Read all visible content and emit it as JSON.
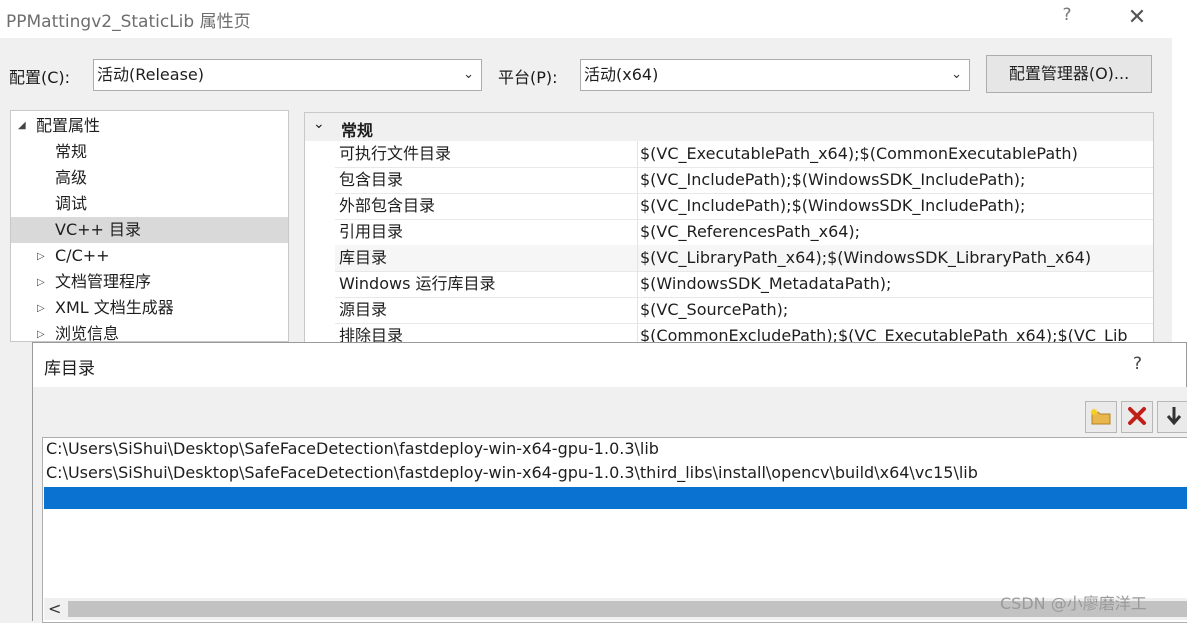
{
  "window": {
    "title": "PPMattingv2_StaticLib 属性页",
    "help": "?",
    "close": "✕"
  },
  "toolbar": {
    "config_label": "配置(C):",
    "config_value": "活动(Release)",
    "platform_label": "平台(P):",
    "platform_value": "活动(x64)",
    "manager_button": "配置管理器(O)..."
  },
  "tree": {
    "root": {
      "label": "配置属性",
      "toggle": "◢"
    },
    "items": [
      {
        "label": "常规"
      },
      {
        "label": "高级"
      },
      {
        "label": "调试"
      },
      {
        "label": "VC++ 目录",
        "selected": true
      }
    ],
    "collapsed": [
      {
        "label": "C/C++",
        "toggle": "▷"
      },
      {
        "label": "文档管理程序",
        "toggle": "▷"
      },
      {
        "label": "XML 文档生成器",
        "toggle": "▷"
      },
      {
        "label": "浏览信息",
        "toggle": "▷"
      }
    ]
  },
  "grid": {
    "section_toggle": "⌄",
    "section_title": "常规",
    "rows": [
      {
        "name": "可执行文件目录",
        "value": "$(VC_ExecutablePath_x64);$(CommonExecutablePath)"
      },
      {
        "name": "包含目录",
        "value": "$(VC_IncludePath);$(WindowsSDK_IncludePath);"
      },
      {
        "name": "外部包含目录",
        "value": "$(VC_IncludePath);$(WindowsSDK_IncludePath);"
      },
      {
        "name": "引用目录",
        "value": "$(VC_ReferencesPath_x64);"
      },
      {
        "name": "库目录",
        "value": "$(VC_LibraryPath_x64);$(WindowsSDK_LibraryPath_x64)"
      },
      {
        "name": "Windows 运行库目录",
        "value": "$(WindowsSDK_MetadataPath);"
      },
      {
        "name": "源目录",
        "value": "$(VC_SourcePath);"
      },
      {
        "name": "排除目录",
        "value": "$(CommonExcludePath);$(VC_ExecutablePath_x64);$(VC_Lib"
      }
    ]
  },
  "dialog": {
    "title": "库目录",
    "help": "?",
    "buttons": {
      "new_line_icon": "new-folder-icon",
      "delete_icon": "delete-x-icon",
      "move_down_icon": "arrow-down-icon"
    },
    "paths": [
      "C:\\Users\\SiShui\\Desktop\\SafeFaceDetection\\fastdeploy-win-x64-gpu-1.0.3\\lib",
      "C:\\Users\\SiShui\\Desktop\\SafeFaceDetection\\fastdeploy-win-x64-gpu-1.0.3\\third_libs\\install\\opencv\\build\\x64\\vc15\\lib",
      ""
    ],
    "scroll_left": "<"
  },
  "watermark": "CSDN @小廖磨洋工",
  "colors": {
    "selection": "#0a73d1",
    "tree_selected": "#d9d9d9"
  }
}
